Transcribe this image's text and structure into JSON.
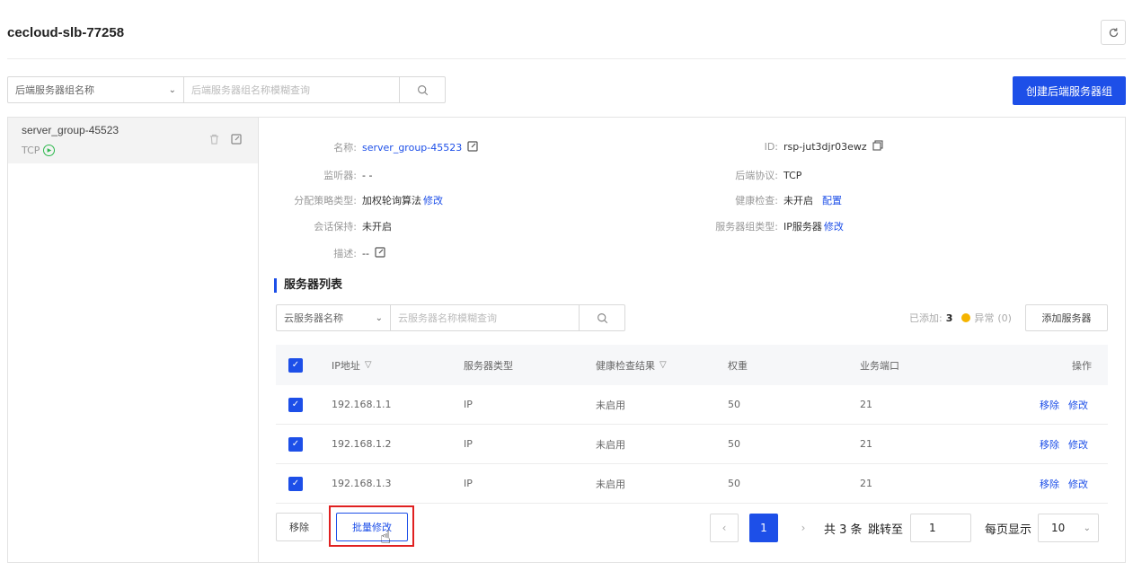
{
  "page": {
    "title": "cecloud-slb-77258"
  },
  "group_search": {
    "select_label": "后端服务器组名称",
    "placeholder": "后端服务器组名称模糊查询"
  },
  "create_button": "创建后端服务器组",
  "groups": [
    {
      "name": "server_group-45523",
      "protocol": "TCP"
    }
  ],
  "detail": {
    "name_label": "名称:",
    "name_value": "server_group-45523",
    "listener_label": "监听器:",
    "listener_value": "- -",
    "strategy_label": "分配策略类型:",
    "strategy_value": "加权轮询算法",
    "strategy_link": "修改",
    "session_label": "会话保持:",
    "session_value": "未开启",
    "desc_label": "描述:",
    "desc_value": "--",
    "id_label": "ID:",
    "id_value": "rsp-jut3djr03ewz",
    "protocol_label": "后端协议:",
    "protocol_value": "TCP",
    "health_label": "健康检查:",
    "health_value": "未开启",
    "health_link": "配置",
    "type_label": "服务器组类型:",
    "type_value": "IP服务器",
    "type_link": "修改"
  },
  "server_list": {
    "title": "服务器列表",
    "select_label": "云服务器名称",
    "placeholder": "云服务器名称模糊查询",
    "added_label": "已添加:",
    "added_count": "3",
    "abnormal_label": "异常",
    "abnormal_count": "(0)",
    "add_button": "添加服务器",
    "columns": [
      "IP地址",
      "服务器类型",
      "健康检查结果",
      "权重",
      "业务端口",
      "操作"
    ],
    "rows": [
      {
        "ip": "192.168.1.1",
        "type": "IP",
        "health": "未启用",
        "weight": "50",
        "port": "21"
      },
      {
        "ip": "192.168.1.2",
        "type": "IP",
        "health": "未启用",
        "weight": "50",
        "port": "21"
      },
      {
        "ip": "192.168.1.3",
        "type": "IP",
        "health": "未启用",
        "weight": "50",
        "port": "21"
      }
    ],
    "row_actions": {
      "remove": "移除",
      "edit": "修改"
    }
  },
  "footer": {
    "remove_button": "移除",
    "batch_edit_button": "批量修改",
    "current_page": "1",
    "total_text": "共 3 条",
    "jump_label": "跳转至",
    "jump_value": "1",
    "page_size_label": "每页显示",
    "page_size_value": "10"
  },
  "colors": {
    "accent": "#1d4fe8",
    "highlight": "#e02020",
    "warning": "#f5b400",
    "running": "#2db84d"
  }
}
